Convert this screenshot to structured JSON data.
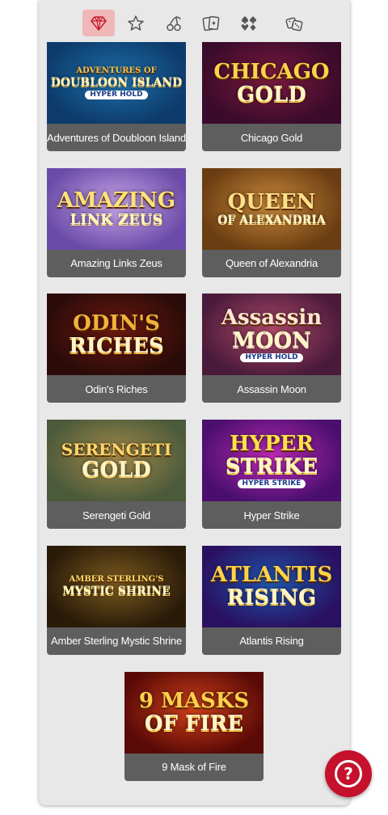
{
  "categories": [
    {
      "name": "diamond-icon",
      "active": true
    },
    {
      "name": "star-icon",
      "active": false
    },
    {
      "name": "cherries-icon",
      "active": false
    },
    {
      "name": "playing-cards-icon",
      "active": false
    },
    {
      "name": "card-suits-icon",
      "active": false
    },
    {
      "name": "dice-icon",
      "active": false
    }
  ],
  "games": [
    {
      "title": "Adventures of Doubloon Island",
      "art": [
        "ADVENTURES OF",
        "DOUBLOON ISLAND",
        "HYPER HOLD"
      ],
      "colors": [
        "#0d3b6b",
        "#1e6fa8",
        "#f6c14a"
      ]
    },
    {
      "title": "Chicago Gold",
      "art": [
        "CHICAGO",
        "GOLD",
        ""
      ],
      "colors": [
        "#3a0b2a",
        "#7b1a3e",
        "#ffd24a"
      ]
    },
    {
      "title": "Amazing Links Zeus",
      "art": [
        "AMAZING",
        "LINK ZEUS",
        ""
      ],
      "colors": [
        "#6a4ba8",
        "#c9a6e8",
        "#ffe27a"
      ]
    },
    {
      "title": "Queen of Alexandria",
      "art": [
        "QUEEN",
        "OF ALEXANDRIA",
        ""
      ],
      "colors": [
        "#6b3d12",
        "#c98a3a",
        "#ffe08a"
      ]
    },
    {
      "title": "Odin's Riches",
      "art": [
        "ODIN'S",
        "RICHES",
        ""
      ],
      "colors": [
        "#2a0b08",
        "#6e1a10",
        "#f2b23a"
      ]
    },
    {
      "title": "Assassin Moon",
      "art": [
        "Assassin",
        "MOON",
        "HYPER HOLD"
      ],
      "colors": [
        "#4a1a3a",
        "#b04a6a",
        "#ffe6d0"
      ]
    },
    {
      "title": "Serengeti Gold",
      "art": [
        "SERENGETI",
        "GOLD",
        ""
      ],
      "colors": [
        "#4b5a3a",
        "#a38a4a",
        "#ffd76a"
      ]
    },
    {
      "title": "Hyper Strike",
      "art": [
        "HYPER",
        "STRIKE",
        "HYPER STRIKE"
      ],
      "colors": [
        "#4a0f6e",
        "#c02ab8",
        "#ffe14a"
      ]
    },
    {
      "title": "Amber Sterling Mystic Shrine",
      "art": [
        "AMBER STERLING'S",
        "MYSTIC SHRINE",
        ""
      ],
      "colors": [
        "#2a1a08",
        "#7a5a20",
        "#ffd86a"
      ]
    },
    {
      "title": "Atlantis Rising",
      "art": [
        "ATLANTIS",
        "RISING",
        ""
      ],
      "colors": [
        "#2a1060",
        "#1e58b0",
        "#ffd24a"
      ]
    },
    {
      "title": "9 Mask of Fire",
      "art": [
        "9 MASKS",
        "OF FIRE",
        ""
      ],
      "colors": [
        "#5a0a06",
        "#d0401a",
        "#ffd04a"
      ]
    }
  ],
  "help": {
    "icon": "question-icon",
    "glyph": "?"
  }
}
